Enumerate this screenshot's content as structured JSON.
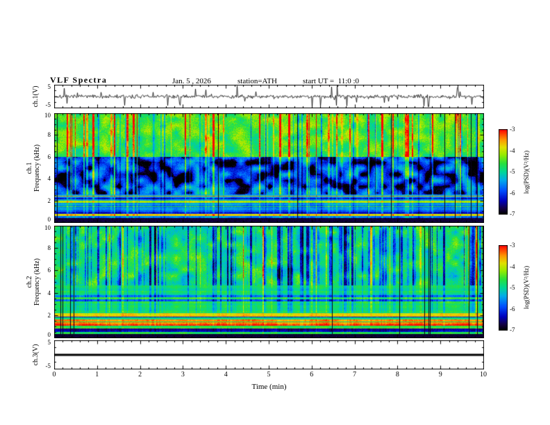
{
  "header": {
    "title": "VLF Spectra",
    "date": "Jan. 5 , 2026",
    "station": "station=ATH",
    "start_ut": "start UT =  11:0 :0"
  },
  "xaxis": {
    "label": "Time (min)",
    "tick_labels": [
      "0",
      "1",
      "2",
      "3",
      "4",
      "5",
      "6",
      "7",
      "8",
      "9",
      "10"
    ],
    "range": [
      0,
      10
    ]
  },
  "panels": {
    "ch1_wave": {
      "ylabel": "ch.1(V)",
      "ylim": [
        -5,
        5
      ],
      "yticks": [
        {
          "value": 5,
          "label": "5"
        },
        {
          "value": -5,
          "label": "-5"
        }
      ]
    },
    "ch1_spec": {
      "ylabel_line1": "ch.1",
      "ylabel_line2": "Frequency (kHz)",
      "ylim": [
        0,
        10
      ],
      "yticks": [
        {
          "value": 10,
          "label": "10"
        },
        {
          "value": 8,
          "label": "8"
        },
        {
          "value": 6,
          "label": "6"
        },
        {
          "value": 4,
          "label": "4"
        },
        {
          "value": 2,
          "label": "2"
        },
        {
          "value": 0,
          "label": "0"
        }
      ]
    },
    "ch2_spec": {
      "ylabel_line1": "ch.2",
      "ylabel_line2": "Frequency (kHz)",
      "ylim": [
        0,
        10
      ],
      "yticks": [
        {
          "value": 10,
          "label": "10"
        },
        {
          "value": 8,
          "label": "8"
        },
        {
          "value": 6,
          "label": "6"
        },
        {
          "value": 4,
          "label": "4"
        },
        {
          "value": 2,
          "label": "2"
        },
        {
          "value": 0,
          "label": "0"
        }
      ]
    },
    "ch3_wave": {
      "ylabel": "ch.3(V)",
      "ylim": [
        -5,
        5
      ],
      "yticks": [
        {
          "value": 5,
          "label": "5"
        },
        {
          "value": -5,
          "label": "-5"
        }
      ]
    }
  },
  "colorbars": [
    {
      "label": "log(PSD)(V²/Hz)",
      "tick_labels": [
        "-3",
        "-4",
        "-5",
        "-6",
        "-7"
      ],
      "max": -3,
      "min": -7
    },
    {
      "label": "log(PSD)(V²/Hz)",
      "tick_labels": [
        "-3",
        "-4",
        "-5",
        "-6",
        "-7"
      ],
      "max": -3,
      "min": -7
    }
  ],
  "chart_data": [
    {
      "type": "line",
      "id": "ch1-waveform",
      "ylabel": "ch.1(V)",
      "ylim": [
        -5,
        5
      ],
      "xlim": [
        0,
        10
      ],
      "xlabel": "Time (min)",
      "description": "Noisy broadband voltage trace, baseline about ±1 V with frequent impulsive spikes reaching toward ±5 V across the full 10 minutes",
      "gen": {
        "seed": 7,
        "noise_amp": 0.8,
        "spike_prob": 0.05,
        "spike_min": 1.2,
        "spike_max": 4.6,
        "down_bias": 0.55
      }
    },
    {
      "type": "heatmap",
      "id": "ch1-spectrogram",
      "ylabel": "ch.1 Frequency (kHz)",
      "xlabel": "Time (min)",
      "xlim": [
        0,
        10
      ],
      "ylim": [
        0,
        10
      ],
      "colorbar": {
        "label": "log(PSD)(V²/Hz)",
        "min": -7,
        "max": -3
      },
      "features": [
        "green-yellow background 6-10 kHz with dense red broadband impulse streaks",
        "blue background 2.6-6 kHz with dark-blue patches and cyan vertical streaks",
        "horizontal spectral line structure 0.45-2.6 kHz (green/yellow lines over cyan-blue)",
        "black low-power band below 0.45 kHz",
        "vertical broadband sferic impulses spanning all frequencies"
      ],
      "gen": {
        "seed": 42,
        "streak_prob": 0.12,
        "neg_streak_prob": 0.05,
        "black_prob": 0.008,
        "band_fmax": 2.6,
        "blue_fmax": 6.0,
        "black_band_fmax": 0.45
      }
    },
    {
      "type": "heatmap",
      "id": "ch2-spectrogram",
      "ylabel": "ch.2 Frequency (kHz)",
      "xlabel": "Time (min)",
      "xlim": [
        0,
        10
      ],
      "ylim": [
        0,
        10
      ],
      "colorbar": {
        "label": "log(PSD)(V²/Hz)",
        "min": -7,
        "max": -3
      },
      "features": [
        "green background 4.7-10 kHz with many blue/dark vertical streaks and occasional black dropout columns",
        "moderate horizontal banding 2.3-4.7 kHz",
        "strong horizontal red/orange and dark bands 0.4-2.3 kHz (power-line harmonics)",
        "black low-power band below 0.4 kHz"
      ],
      "gen": {
        "seed": 1337,
        "neg_streak_prob": 0.16,
        "pos_streak_prob": 0.03,
        "black_prob": 0.025,
        "band_low_fmax": 2.3,
        "band_mid_fmax": 4.7,
        "black_band_fmax": 0.4
      }
    },
    {
      "type": "line",
      "id": "ch3-waveform",
      "ylabel": "ch.3(V)",
      "ylim": [
        -5,
        5
      ],
      "xlim": [
        0,
        10
      ],
      "value_volts": 0,
      "description": "Constant flat trace at 0 V (channel inactive) drawn as a thick black line"
    }
  ]
}
